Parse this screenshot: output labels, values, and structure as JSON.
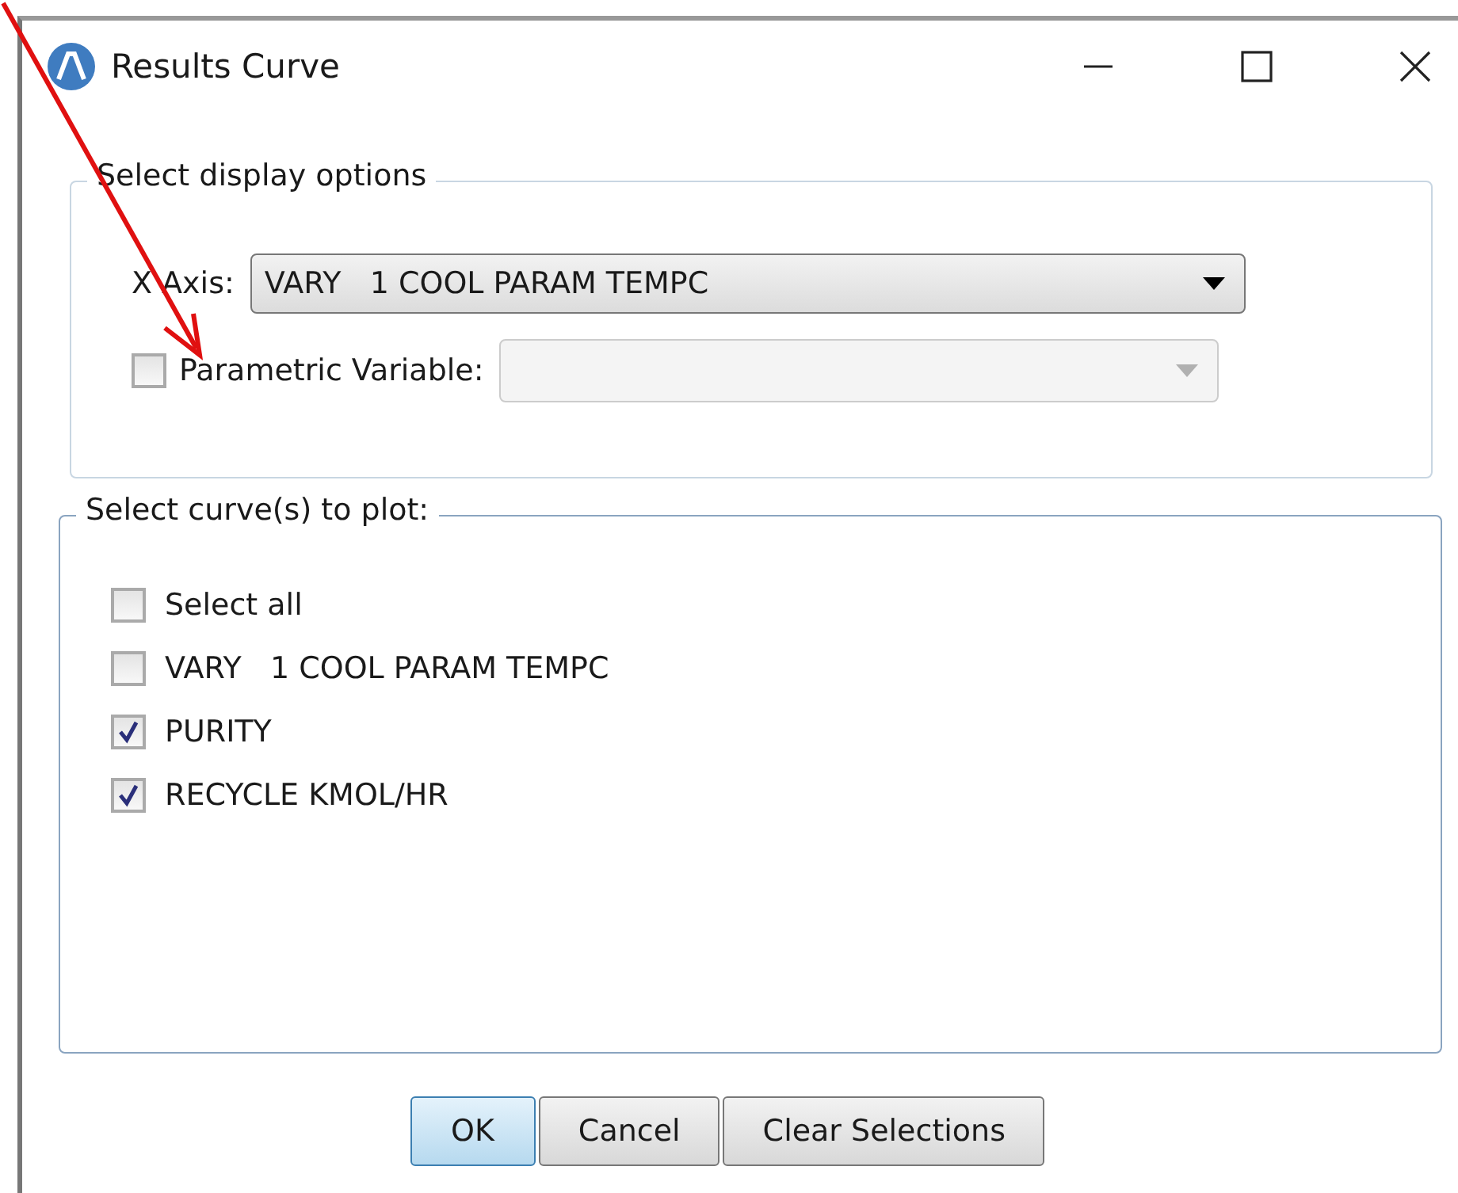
{
  "window": {
    "title": "Results Curve"
  },
  "display_options": {
    "title": "Select display options",
    "x_axis": {
      "label": "X Axis:",
      "value": "VARY   1 COOL PARAM TEMPC"
    },
    "parametric": {
      "label": "Parametric Variable:",
      "checked": false,
      "dropdown_disabled": true
    }
  },
  "curves": {
    "title": "Select curve(s) to plot:",
    "items": [
      {
        "label": "Select all",
        "checked": false
      },
      {
        "label": "VARY   1 COOL PARAM TEMPC",
        "checked": false
      },
      {
        "label": "PURITY",
        "checked": true
      },
      {
        "label": "RECYCLE KMOL/HR",
        "checked": true
      }
    ]
  },
  "buttons": [
    {
      "label": "OK",
      "default": true
    },
    {
      "label": "Cancel",
      "default": false
    },
    {
      "label": "Clear Selections",
      "default": false
    }
  ]
}
